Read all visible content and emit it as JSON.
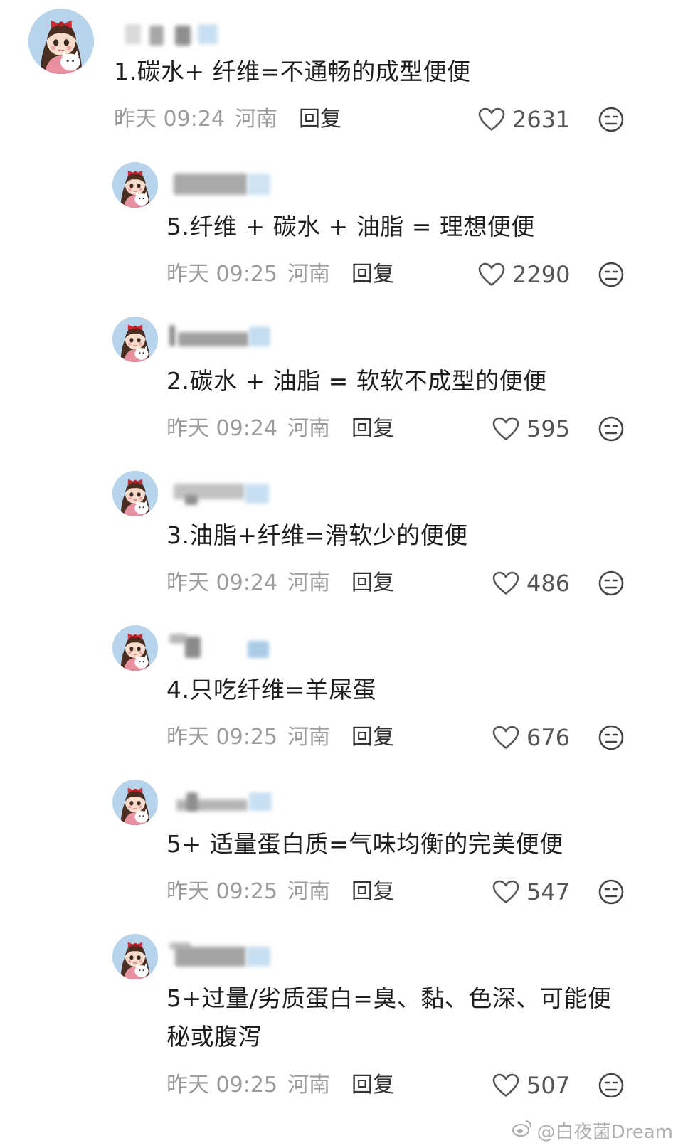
{
  "colors": {
    "text": "#1e1e1e",
    "meta": "#9b9b9b",
    "reply": "#333333",
    "like": "#555555"
  },
  "icons": {
    "like": "heart-outline-icon",
    "dislike": "neutral-face-icon",
    "watermark": "weibo-logo-icon"
  },
  "comments": [
    {
      "text": "1.碳水+ 纤维=不通畅的成型便便",
      "date": "昨天 09:24",
      "region": "河南",
      "reply_label": "回复",
      "likes": "2631"
    },
    {
      "text": "5.纤维 + 碳水 + 油脂 = 理想便便",
      "date": "昨天 09:25",
      "region": "河南",
      "reply_label": "回复",
      "likes": "2290"
    },
    {
      "text": "2.碳水 + 油脂 = 软软不成型的便便",
      "date": "昨天 09:24",
      "region": "河南",
      "reply_label": "回复",
      "likes": "595"
    },
    {
      "text": "3.油脂+纤维=滑软少的便便",
      "date": "昨天 09:24",
      "region": "河南",
      "reply_label": "回复",
      "likes": "486"
    },
    {
      "text": "4.只吃纤维=羊屎蛋",
      "date": "昨天 09:25",
      "region": "河南",
      "reply_label": "回复",
      "likes": "676"
    },
    {
      "text": "5+ 适量蛋白质=气味均衡的完美便便",
      "date": "昨天 09:25",
      "region": "河南",
      "reply_label": "回复",
      "likes": "547"
    },
    {
      "text": "5+过量/劣质蛋白=臭、黏、色深、可能便\n秘或腹泻",
      "date": "昨天 09:25",
      "region": "河南",
      "reply_label": "回复",
      "likes": "507"
    }
  ],
  "watermark": {
    "text": "@白夜菌Dream"
  }
}
